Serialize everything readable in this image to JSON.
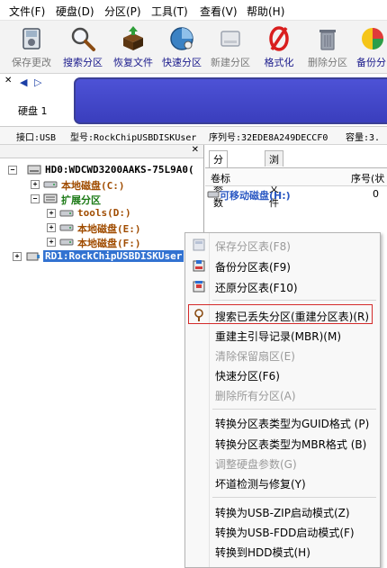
{
  "menu": [
    "文件(F)",
    "硬盘(D)",
    "分区(P)",
    "工具(T)",
    "查看(V)",
    "帮助(H)"
  ],
  "toolbar": {
    "save": "保存更改",
    "search": "搜索分区",
    "recover": "恢复文件",
    "quick": "快速分区",
    "new": "新建分区",
    "format": "格式化",
    "delete": "删除分区",
    "backup": "备份分"
  },
  "diskbar": {
    "label": "硬盘 1"
  },
  "info": {
    "interface": "接口:USB",
    "model": "型号:RockChipUSBDISKUser",
    "serial": "序列号:32EDE8A249DECCF0",
    "capacity": "容量:3."
  },
  "tree": {
    "hd0": "HD0:WDCWD3200AAKS-75L9A0(",
    "local_c": "本地磁盘(C:)",
    "extended": "扩展分区",
    "tools": "tools(D:)",
    "local_e": "本地磁盘(E:)",
    "local_f": "本地磁盘(F:)",
    "rd1": "RD1:RockChipUSBDISKUser"
  },
  "right": {
    "tab_params": "分区参数",
    "tab_browse": "浏览文件",
    "col_label": "卷标",
    "col_seq": "序号(状",
    "row_name": "可移动磁盘(H:)",
    "row_seq": "0"
  },
  "context_menu": [
    {
      "label": "保存分区表(F8)",
      "disabled": true,
      "icon": "save-icon"
    },
    {
      "label": "备份分区表(F9)",
      "disabled": false,
      "icon": "backup-icon"
    },
    {
      "label": "还原分区表(F10)",
      "disabled": false,
      "icon": "restore-icon"
    },
    {
      "label": "搜索已丢失分区(重建分区表)(R)",
      "disabled": false,
      "icon": "search-icon"
    },
    {
      "label": "重建主引导记录(MBR)(M)",
      "disabled": false
    },
    {
      "label": "清除保留扇区(E)",
      "disabled": true
    },
    {
      "label": "快速分区(F6)",
      "disabled": false
    },
    {
      "label": "删除所有分区(A)",
      "disabled": true
    },
    {
      "label": "转换分区表类型为GUID格式 (P)",
      "disabled": false
    },
    {
      "label": "转换分区表类型为MBR格式 (B)",
      "disabled": false
    },
    {
      "label": "调整硬盘参数(G)",
      "disabled": true
    },
    {
      "label": "坏道检测与修复(Y)",
      "disabled": false
    },
    {
      "label": "转换为USB-ZIP启动模式(Z)",
      "disabled": false
    },
    {
      "label": "转换为USB-FDD启动模式(F)",
      "disabled": false
    },
    {
      "label": "转换到HDD模式(H)",
      "disabled": false
    }
  ],
  "colors": {
    "accent_blue": "#3272d1",
    "partition_bar": "#4046c8",
    "highlight_border": "#d42a2a"
  }
}
